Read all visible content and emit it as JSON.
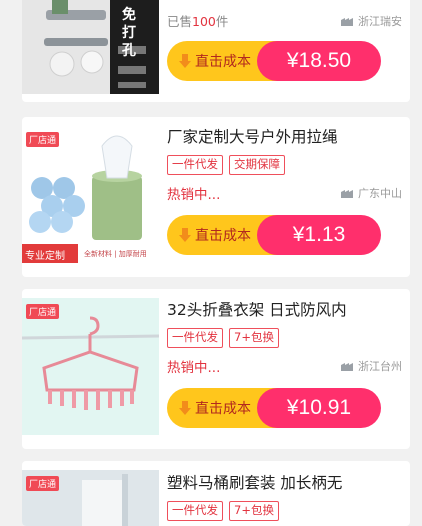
{
  "products": [
    {
      "title": "",
      "tags": [],
      "sold_prefix": "已售",
      "sold_count": "100",
      "sold_suffix": "件",
      "location": "浙江瑞安",
      "cost_label": "直击成本",
      "price": "¥18.50",
      "image_text": "免打孔",
      "badge": ""
    },
    {
      "title": "厂家定制大号户外用拉绳",
      "tags": [
        "一件代发",
        "交期保障"
      ],
      "status": "热销中...",
      "location": "广东中山",
      "cost_label": "直击成本",
      "price": "¥1.13",
      "badge": "厂店通",
      "image_caption_left": "专业定制",
      "image_caption_right": "全新材料 | 加厚耐用"
    },
    {
      "title": "32头折叠衣架 日式防风内",
      "tags": [
        "一件代发",
        "7+包换"
      ],
      "status": "热销中...",
      "location": "浙江台州",
      "cost_label": "直击成本",
      "price": "¥10.91",
      "badge": "厂店通"
    },
    {
      "title": "塑料马桶刷套装 加长柄无",
      "tags": [
        "一件代发",
        "7+包换"
      ],
      "badge": "厂店通"
    }
  ],
  "colors": {
    "accent_red": "#e2333f",
    "price_pink": "#ff2f6c",
    "cost_yellow": "#ffc61c"
  }
}
